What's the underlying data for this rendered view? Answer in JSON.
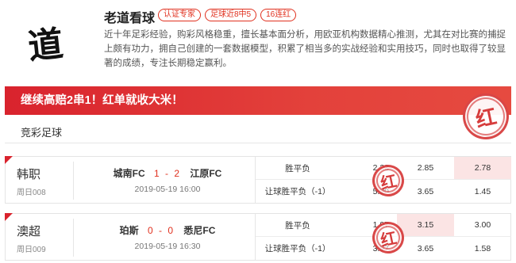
{
  "profile": {
    "avatar_glyph": "道",
    "name": "老道看球",
    "tags": [
      "认证专家",
      "足球近8中5",
      "16连红"
    ],
    "bio": "近十年足彩经验，购彩风格稳重，擅长基本面分析，用欧亚机构数据精心推测，尤其在对比赛的捕捉上颇有功力，拥自己创建的一套数据模型，积累了相当多的实战经验和实用技巧，同时也取得了较显著的成绩，专注长期稳定赢利。"
  },
  "banner": {
    "text": "继续高赔2串1！红单就收大米！"
  },
  "stamp_glyph": "红",
  "section": {
    "title": "竞彩足球"
  },
  "colors": {
    "accent": "#d9232d",
    "highlight": "#fbe4e4"
  },
  "matches": [
    {
      "league": "韩职",
      "week_no": "周日008",
      "home": "城南FC",
      "score": "1 - 2",
      "away": "江原FC",
      "kickoff": "2019-05-19 16:00",
      "rows": [
        {
          "label": "胜平负",
          "handicap": "",
          "odds": [
            "2.23",
            "2.85",
            "2.78"
          ],
          "highlight_index": 2
        },
        {
          "label": "让球胜平负（-1）",
          "handicap": "",
          "odds": [
            "5.20",
            "3.65",
            "1.45"
          ],
          "highlight_index": -1
        }
      ]
    },
    {
      "league": "澳超",
      "week_no": "周日009",
      "home": "珀斯",
      "score": "0 - 0",
      "away": "悉尼FC",
      "kickoff": "2019-05-19 16:30",
      "rows": [
        {
          "label": "胜平负",
          "handicap": "",
          "odds": [
            "1.97",
            "3.15",
            "3.00"
          ],
          "highlight_index": 1
        },
        {
          "label": "让球胜平负（-1）",
          "handicap": "",
          "odds": [
            "3.97",
            "3.65",
            "1.58"
          ],
          "highlight_index": -1
        }
      ]
    }
  ]
}
